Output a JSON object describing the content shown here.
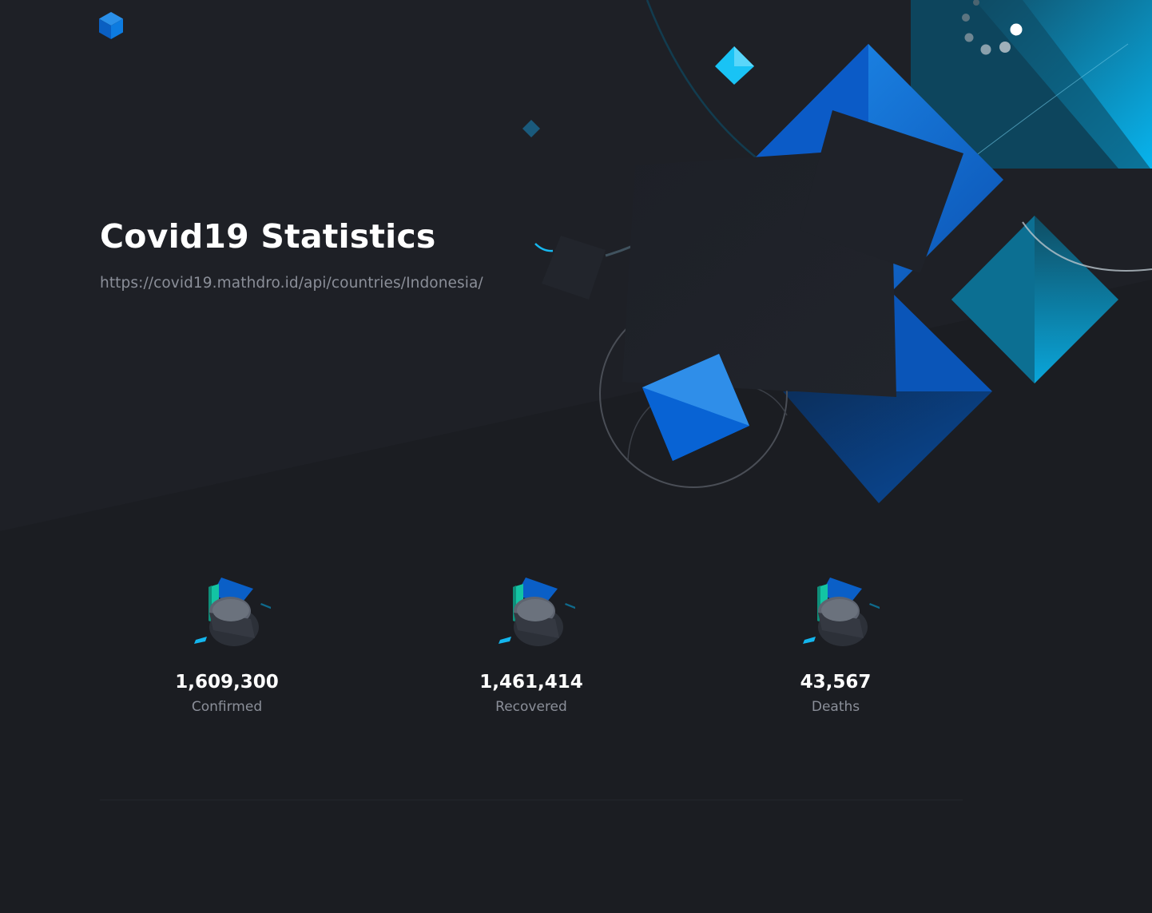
{
  "header": {
    "logo_icon": "cube-logo-icon"
  },
  "hero": {
    "title": "Covid19 Statistics",
    "api_url": "https://covid19.mathdro.id/api/countries/Indonesia/"
  },
  "stats": [
    {
      "value": "1,609,300",
      "label": "Confirmed",
      "icon": "stat-illustration-icon"
    },
    {
      "value": "1,461,414",
      "label": "Recovered",
      "icon": "stat-illustration-icon"
    },
    {
      "value": "43,567",
      "label": "Deaths",
      "icon": "stat-illustration-icon"
    }
  ],
  "colors": {
    "background": "#1b1d22",
    "accent_blue": "#0a6cdb",
    "accent_cyan": "#16b8f0",
    "muted_text": "#8b8f99"
  }
}
